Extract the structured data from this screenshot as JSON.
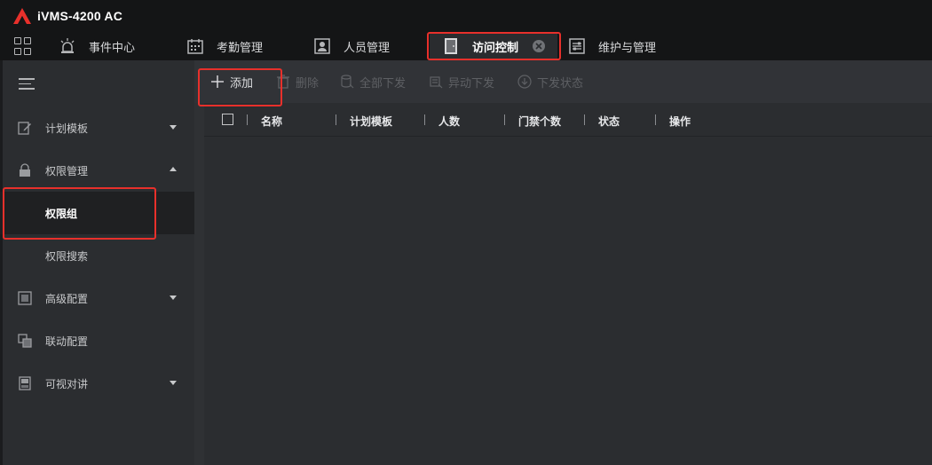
{
  "app": {
    "title": "iVMS-4200 AC",
    "logo_icon": "hikvision-logo",
    "accent_color": "#e8302b"
  },
  "tabs": [
    {
      "label": "事件中心",
      "icon": "alarm-light-icon"
    },
    {
      "label": "考勤管理",
      "icon": "calendar-icon"
    },
    {
      "label": "人员管理",
      "icon": "person-card-icon"
    },
    {
      "label": "访问控制",
      "icon": "door-icon",
      "active": true
    },
    {
      "label": "维护与管理",
      "icon": "settings-panel-icon"
    }
  ],
  "sidebar": {
    "items": [
      {
        "label": "计划模板",
        "icon": "edit-icon",
        "expandable": true,
        "expanded": false
      },
      {
        "label": "权限管理",
        "icon": "lock-icon",
        "expandable": true,
        "expanded": true
      },
      {
        "label": "权限组",
        "selected": true
      },
      {
        "label": "权限搜索"
      },
      {
        "label": "高级配置",
        "icon": "config-icon",
        "expandable": true,
        "expanded": false
      },
      {
        "label": "联动配置",
        "icon": "linkage-icon"
      },
      {
        "label": "可视对讲",
        "icon": "intercom-icon",
        "expandable": true,
        "expanded": false
      }
    ]
  },
  "toolbar": {
    "add": "添加",
    "delete": "删除",
    "apply_all": "全部下发",
    "apply_abnormal": "异动下发",
    "apply_status": "下发状态"
  },
  "table": {
    "columns": [
      "名称",
      "计划模板",
      "人数",
      "门禁个数",
      "状态",
      "操作"
    ],
    "rows": []
  }
}
